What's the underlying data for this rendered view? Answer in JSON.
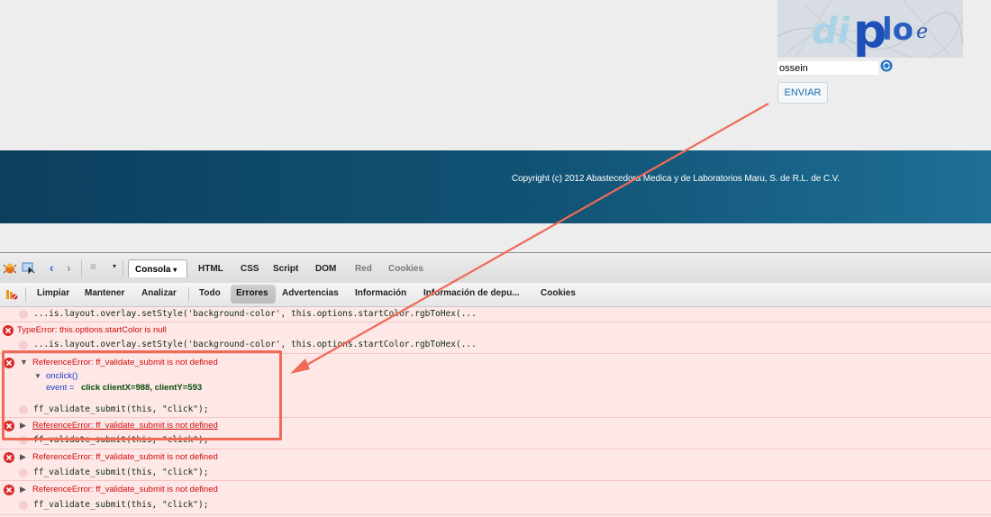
{
  "page": {
    "captcha": {
      "input_value": "ossein",
      "image_text": "diploe"
    },
    "submit_label": "ENVIAR",
    "footer": {
      "copyright": "Copyright (c) 2012 Abastecedora Medica y de Laboratorios Maru, S. de R.L. de C.V."
    }
  },
  "firebug": {
    "panel_tabs": {
      "console": "Consola",
      "html": "HTML",
      "css": "CSS",
      "script": "Script",
      "dom": "DOM",
      "red": "Red",
      "cookies": "Cookies"
    },
    "filters": {
      "clear": "Limpiar",
      "persist": "Mantener",
      "profile": "Analizar",
      "all": "Todo",
      "errors": "Errores",
      "warnings": "Advertencias",
      "info": "Información",
      "debug": "Información de depu...",
      "cookies": "Cookies"
    },
    "log": {
      "row1_code": "...is.layout.overlay.setStyle('background-color', this.options.startColor.rgbToHex(...",
      "row2_error": "TypeError: this.options.startColor is null",
      "row2_code": "...is.layout.overlay.setStyle('background-color', this.options.startColor.rgbToHex(...",
      "row3_error": "ReferenceError: ff_validate_submit is not defined",
      "row3_onclick": "onclick()",
      "row3_event_label": "event = ",
      "row3_event_value": "click clientX=988, clientY=593",
      "row3_code": "ff_validate_submit(this, \"click\");",
      "row4_error": "ReferenceError: ff_validate_submit is not defined",
      "row4_code": "ff_validate_submit(this, \"click\");",
      "row5_error": "ReferenceError: ff_validate_submit is not defined",
      "row5_code": "ff_validate_submit(this, \"click\");",
      "row6_error": "ReferenceError: ff_validate_submit is not defined",
      "row6_code": "ff_validate_submit(this, \"click\");"
    }
  },
  "colors": {
    "annotation": "#ef6a57",
    "error_text": "#d30c0c",
    "log_background": "#fde7e7",
    "footer": "#115375"
  }
}
